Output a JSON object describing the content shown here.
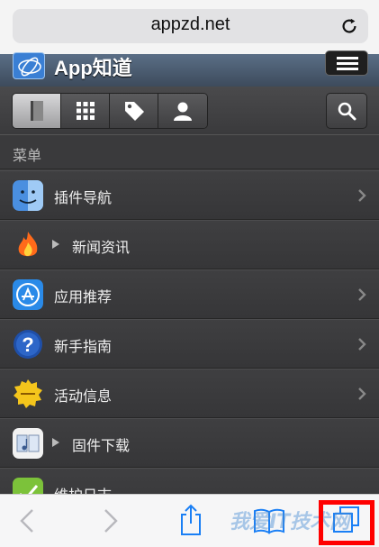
{
  "browser": {
    "url": "appzd.net"
  },
  "app": {
    "title": "App知道"
  },
  "menu": {
    "heading": "菜单",
    "items": [
      {
        "label": "插件导航",
        "icon": "finder-icon",
        "expandable": false
      },
      {
        "label": "新闻资讯",
        "icon": "fire-icon",
        "expandable": true
      },
      {
        "label": "应用推荐",
        "icon": "app-store-icon",
        "expandable": false
      },
      {
        "label": "新手指南",
        "icon": "help-icon",
        "expandable": false
      },
      {
        "label": "活动信息",
        "icon": "offer-icon",
        "expandable": false
      },
      {
        "label": "固件下载",
        "icon": "itunes-icon",
        "expandable": true
      },
      {
        "label": "维护日志",
        "icon": "check-icon",
        "expandable": false
      }
    ]
  },
  "watermark": {
    "text": "我爱IT技术网"
  },
  "colors": {
    "highlight": "#ff0000"
  }
}
